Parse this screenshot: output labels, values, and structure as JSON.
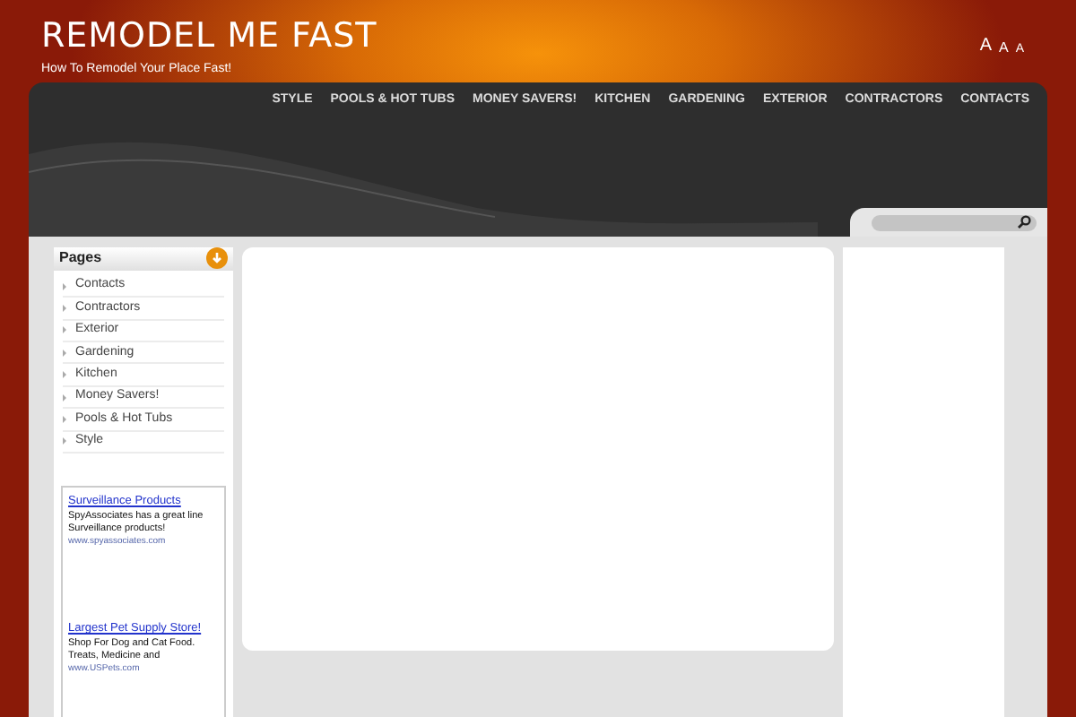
{
  "site": {
    "title": "REMODEL ME FAST",
    "tagline": "How To Remodel Your Place Fast!",
    "font_sizes": [
      "A",
      "A",
      "A"
    ]
  },
  "nav": [
    {
      "label": "STYLE"
    },
    {
      "label": "POOLS & HOT TUBS"
    },
    {
      "label": "MONEY SAVERS!"
    },
    {
      "label": "KITCHEN"
    },
    {
      "label": "GARDENING"
    },
    {
      "label": "EXTERIOR"
    },
    {
      "label": "CONTRACTORS"
    },
    {
      "label": "CONTACTS"
    }
  ],
  "sidebar": {
    "heading": "Pages",
    "items": [
      "Contacts",
      "Contractors",
      "Exterior",
      "Gardening",
      "Kitchen",
      "Money Savers!",
      "Pools & Hot Tubs",
      "Style"
    ]
  },
  "ads": [
    {
      "title": "Surveillance Products",
      "text": "SpyAssociates has a great line Surveillance products!",
      "url": "www.spyassociates.com"
    },
    {
      "title": "Largest Pet Supply Store!",
      "text": "Shop For Dog and Cat Food. Treats, Medicine and",
      "url": "www.USPets.com"
    }
  ]
}
